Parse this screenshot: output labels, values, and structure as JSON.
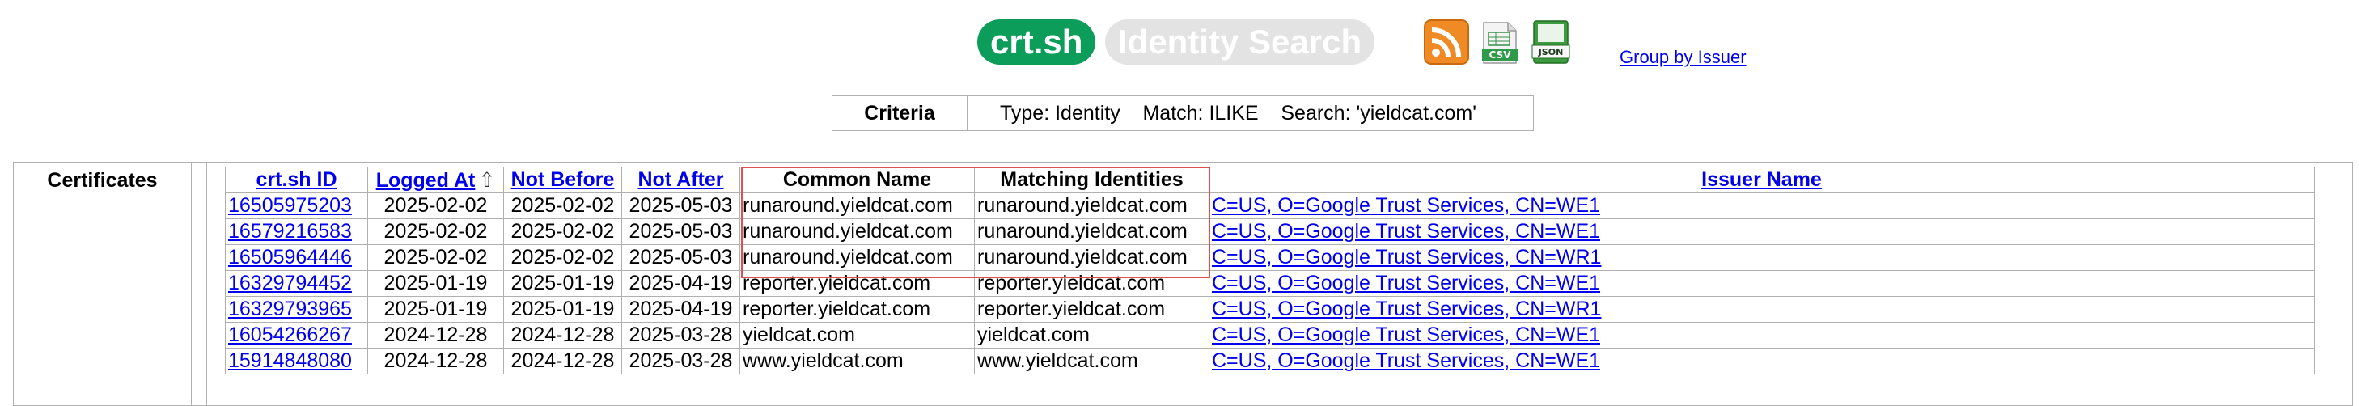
{
  "header": {
    "logo_main": "crt.sh",
    "logo_sub": "Identity Search",
    "icons": [
      {
        "name": "rss-icon",
        "color": "#f08a24"
      },
      {
        "name": "csv-icon",
        "label": "CSV",
        "color": "#2e9a4a"
      },
      {
        "name": "json-icon",
        "label": "JSON",
        "color": "#2e7d32"
      }
    ],
    "group_link": "Group by Issuer"
  },
  "criteria": {
    "label": "Criteria",
    "value": "Type: Identity    Match: ILIKE    Search: 'yieldcat.com'"
  },
  "certificates": {
    "label": "Certificates",
    "columns": [
      "crt.sh ID",
      "Logged At",
      "Not Before",
      "Not After",
      "Common Name",
      "Matching Identities",
      "Issuer Name"
    ],
    "sort_indicator": "⇧",
    "rows": [
      {
        "id": "16505975203",
        "logged": "2025-02-02",
        "not_before": "2025-02-02",
        "not_after": "2025-05-03",
        "cn": "runaround.yieldcat.com",
        "match": "runaround.yieldcat.com",
        "issuer": "C=US, O=Google Trust Services, CN=WE1"
      },
      {
        "id": "16579216583",
        "logged": "2025-02-02",
        "not_before": "2025-02-02",
        "not_after": "2025-05-03",
        "cn": "runaround.yieldcat.com",
        "match": "runaround.yieldcat.com",
        "issuer": "C=US, O=Google Trust Services, CN=WE1"
      },
      {
        "id": "16505964446",
        "logged": "2025-02-02",
        "not_before": "2025-02-02",
        "not_after": "2025-05-03",
        "cn": "runaround.yieldcat.com",
        "match": "runaround.yieldcat.com",
        "issuer": "C=US, O=Google Trust Services, CN=WR1"
      },
      {
        "id": "16329794452",
        "logged": "2025-01-19",
        "not_before": "2025-01-19",
        "not_after": "2025-04-19",
        "cn": "reporter.yieldcat.com",
        "match": "reporter.yieldcat.com",
        "issuer": "C=US, O=Google Trust Services, CN=WE1"
      },
      {
        "id": "16329793965",
        "logged": "2025-01-19",
        "not_before": "2025-01-19",
        "not_after": "2025-04-19",
        "cn": "reporter.yieldcat.com",
        "match": "reporter.yieldcat.com",
        "issuer": "C=US, O=Google Trust Services, CN=WR1"
      },
      {
        "id": "16054266267",
        "logged": "2024-12-28",
        "not_before": "2024-12-28",
        "not_after": "2025-03-28",
        "cn": "yieldcat.com",
        "match": "yieldcat.com",
        "issuer": "C=US, O=Google Trust Services, CN=WE1"
      },
      {
        "id": "15914848080",
        "logged": "2024-12-28",
        "not_before": "2024-12-28",
        "not_after": "2025-03-28",
        "cn": "www.yieldcat.com",
        "match": "www.yieldcat.com",
        "issuer": "C=US, O=Google Trust Services, CN=WE1"
      }
    ]
  },
  "colors": {
    "logo_green": "#0d9d5a",
    "logo_grey": "#e3e3e3",
    "link": "#0000ee",
    "highlight": "#e05050"
  }
}
